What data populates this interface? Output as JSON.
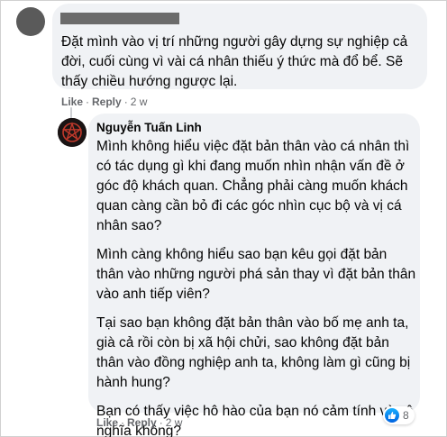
{
  "comment1": {
    "author_redacted": true,
    "text": "Đặt mình vào vị trí những người gây dựng sự nghiệp cả đời, cuối cùng vì vài cá nhân thiếu ý thức mà đổ bể. Sẽ thấy chiều hướng ngược lại.",
    "like_label": "Like",
    "reply_label": "Reply",
    "separator": "·",
    "time": "2 w"
  },
  "comment2": {
    "author": "Nguyễn Tuấn Linh",
    "paragraphs": [
      "Mình không hiểu việc đặt bản thân vào cá nhân thì có tác dụng gì khi đang muốn nhìn nhận vấn đề ở góc độ khách quan. Chẳng phải càng muốn khách quan càng cần bỏ đi các góc nhìn cục bộ và vị cá nhân sao?",
      "Mình càng không hiểu sao bạn kêu gọi đặt bản thân vào những người phá sản thay vì đặt bản thân vào anh tiếp viên?",
      "Tại sao bạn không đặt bản thân vào bố mẹ anh ta, già cả rồi còn bị xã hội chửi, sao không đặt bản thân vào đồng nghiệp anh ta, không làm gì cũng bị hành hung?",
      "Bạn có thấy việc hô hào của bạn nó cảm tính và vô nghĩa không?"
    ],
    "like_label": "Like",
    "reply_label": "Reply",
    "separator": "·",
    "time": "2 w",
    "reaction_count": "8",
    "reaction_icon": "like-reaction-icon"
  },
  "colors": {
    "bubble": "#f0f2f5",
    "meta_text": "#65676b",
    "like_blue": "#0062df"
  }
}
